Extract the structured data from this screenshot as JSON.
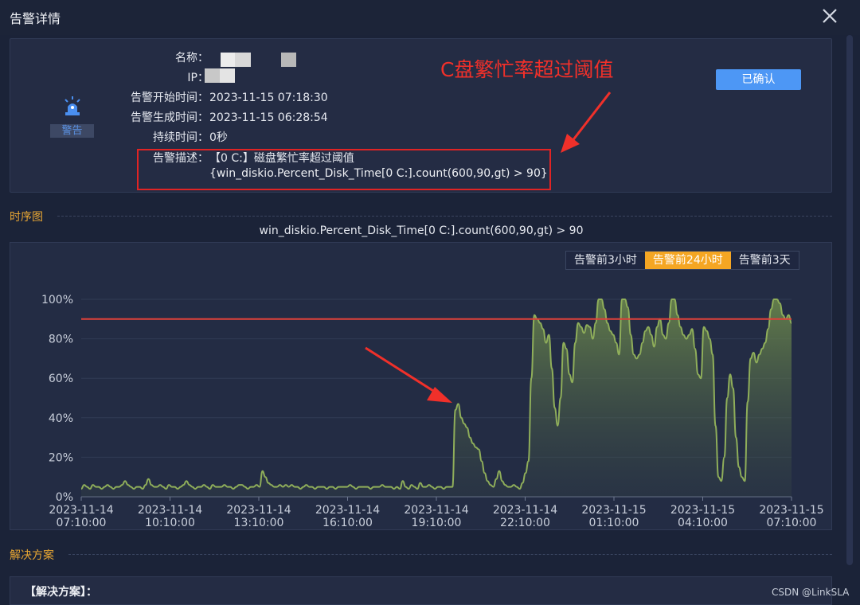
{
  "dialog": {
    "title": "告警详情",
    "close_icon": "close-icon"
  },
  "alert": {
    "level": "警告",
    "icon": "alarm-siren-icon",
    "fields": [
      {
        "label": "名称",
        "value": ""
      },
      {
        "label": "IP",
        "value": ""
      },
      {
        "label": "告警开始时间",
        "value": "2023-11-15 07:18:30"
      },
      {
        "label": "告警生成时间",
        "value": "2023-11-15 06:28:54"
      },
      {
        "label": "持续时间",
        "value": "0秒"
      },
      {
        "label": "告警描述",
        "value": "【0 C:】磁盘繁忙率超过阈值"
      }
    ],
    "description_expr": "{win_diskio.Percent_Disk_Time[0 C:].count(600,90,gt) > 90}",
    "confirm_button": "已确认"
  },
  "annotation": {
    "text": "C盘繁忙率超过阈值",
    "color": "#f0302a"
  },
  "timeseries": {
    "section_title": "时序图",
    "range_tabs": [
      "告警前3小时",
      "告警前24小时",
      "告警前3天"
    ],
    "active_tab": 1
  },
  "solution": {
    "section_title": "解决方案",
    "label": "【解决方案】："
  },
  "watermark": "CSDN @LinkSLA",
  "colors": {
    "accent": "#f5a623",
    "threshold": "#e0413a",
    "series": "#8fae5a",
    "button": "#4d97f5"
  },
  "chart_data": {
    "type": "area",
    "title": "win_diskio.Percent_Disk_Time[0 C:].count(600,90,gt) > 90",
    "ylim": [
      0,
      100
    ],
    "y_ticks": [
      "0%",
      "20%",
      "40%",
      "60%",
      "80%",
      "100%"
    ],
    "x_ticks": [
      [
        "2023-11-14",
        "07:10:00"
      ],
      [
        "2023-11-14",
        "10:10:00"
      ],
      [
        "2023-11-14",
        "13:10:00"
      ],
      [
        "2023-11-14",
        "16:10:00"
      ],
      [
        "2023-11-14",
        "19:10:00"
      ],
      [
        "2023-11-14",
        "22:10:00"
      ],
      [
        "2023-11-15",
        "01:10:00"
      ],
      [
        "2023-11-15",
        "04:10:00"
      ],
      [
        "2023-11-15",
        "07:10:00"
      ]
    ],
    "threshold": 90,
    "series": [
      {
        "values": [
          4,
          6,
          5,
          4,
          6,
          5,
          5,
          4,
          5,
          6,
          5,
          4,
          5,
          5,
          6,
          8,
          6,
          5,
          4,
          5,
          5,
          4,
          6,
          9,
          6,
          5,
          5,
          6,
          5,
          4,
          6,
          5,
          5,
          4,
          5,
          6,
          8,
          6,
          5,
          4,
          5,
          5,
          6,
          5,
          4,
          6,
          5,
          5,
          5,
          6,
          5,
          5,
          4,
          5,
          6,
          6,
          5,
          4,
          5,
          5,
          6,
          5,
          13,
          10,
          7,
          6,
          5,
          5,
          6,
          5,
          6,
          5,
          6,
          5,
          5,
          4,
          5,
          6,
          5,
          5,
          4,
          5,
          5,
          5,
          4,
          5,
          5,
          4,
          5,
          5,
          5,
          5,
          6,
          5,
          4,
          5,
          5,
          5,
          5,
          4,
          5,
          5,
          5,
          6,
          5,
          5,
          5,
          4,
          5,
          4,
          8,
          5,
          4,
          6,
          5,
          4,
          7,
          5,
          5,
          6,
          5,
          4,
          5,
          5,
          4,
          5,
          5,
          5,
          44,
          47,
          40,
          37,
          35,
          30,
          27,
          25,
          24,
          18,
          12,
          8,
          6,
          5,
          9,
          13,
          8,
          6,
          5,
          5,
          6,
          5,
          4,
          7,
          12,
          18,
          60,
          92,
          90,
          88,
          85,
          78,
          82,
          65,
          45,
          36,
          50,
          78,
          75,
          62,
          58,
          78,
          88,
          86,
          83,
          87,
          86,
          80,
          88,
          100,
          100,
          95,
          88,
          84,
          82,
          78,
          72,
          100,
          100,
          96,
          82,
          72,
          70,
          72,
          78,
          84,
          86,
          82,
          76,
          86,
          90,
          82,
          80,
          88,
          100,
          100,
          92,
          86,
          82,
          80,
          82,
          85,
          75,
          62,
          60,
          86,
          84,
          80,
          72,
          36,
          10,
          8,
          20,
          50,
          62,
          55,
          30,
          15,
          10,
          8,
          48,
          70,
          73,
          68,
          72,
          75,
          78,
          85,
          95,
          100,
          100,
          98,
          92,
          90,
          92,
          88
        ]
      }
    ]
  }
}
